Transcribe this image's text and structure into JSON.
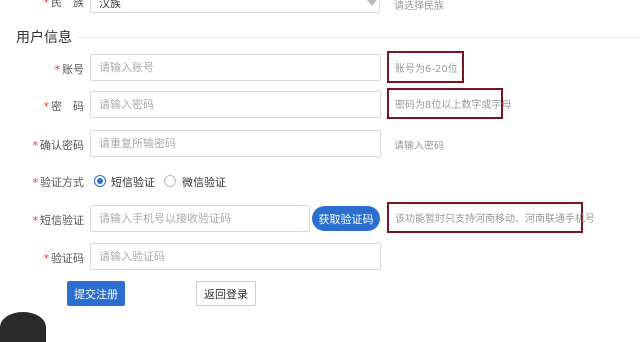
{
  "ethnicity": {
    "label": "民　族",
    "value": "汉族",
    "hint": "请选择民族",
    "caret_icon": "chevron-down-icon"
  },
  "section": {
    "title": "用户信息"
  },
  "required_mark": "*",
  "account": {
    "label": "账号",
    "placeholder": "请输入账号",
    "hint": "账号为6-20位"
  },
  "password": {
    "label": "密　码",
    "placeholder": "请输入密码",
    "hint": "密码为8位以上数字或字母"
  },
  "confirm_password": {
    "label": "确认密码",
    "placeholder": "请重复所输密码",
    "hint": "请输入密码"
  },
  "verify_method": {
    "label": "验证方式",
    "options": [
      {
        "label": "短信验证",
        "selected": true
      },
      {
        "label": "微信验证",
        "selected": false
      }
    ]
  },
  "sms_verify": {
    "label": "短信验证",
    "placeholder": "请输入手机号以接收验证码",
    "button_label": "获取验证码",
    "hint": "该功能暂时只支持河南移动、河南联通手机号"
  },
  "verify_code": {
    "label": "验证码",
    "placeholder": "请输入验证码"
  },
  "actions": {
    "submit_label": "提交注册",
    "back_label": "返回登录"
  },
  "colors": {
    "primary": "#2b6fce",
    "required": "#e0342c",
    "highlight_box": "#7a1420"
  }
}
